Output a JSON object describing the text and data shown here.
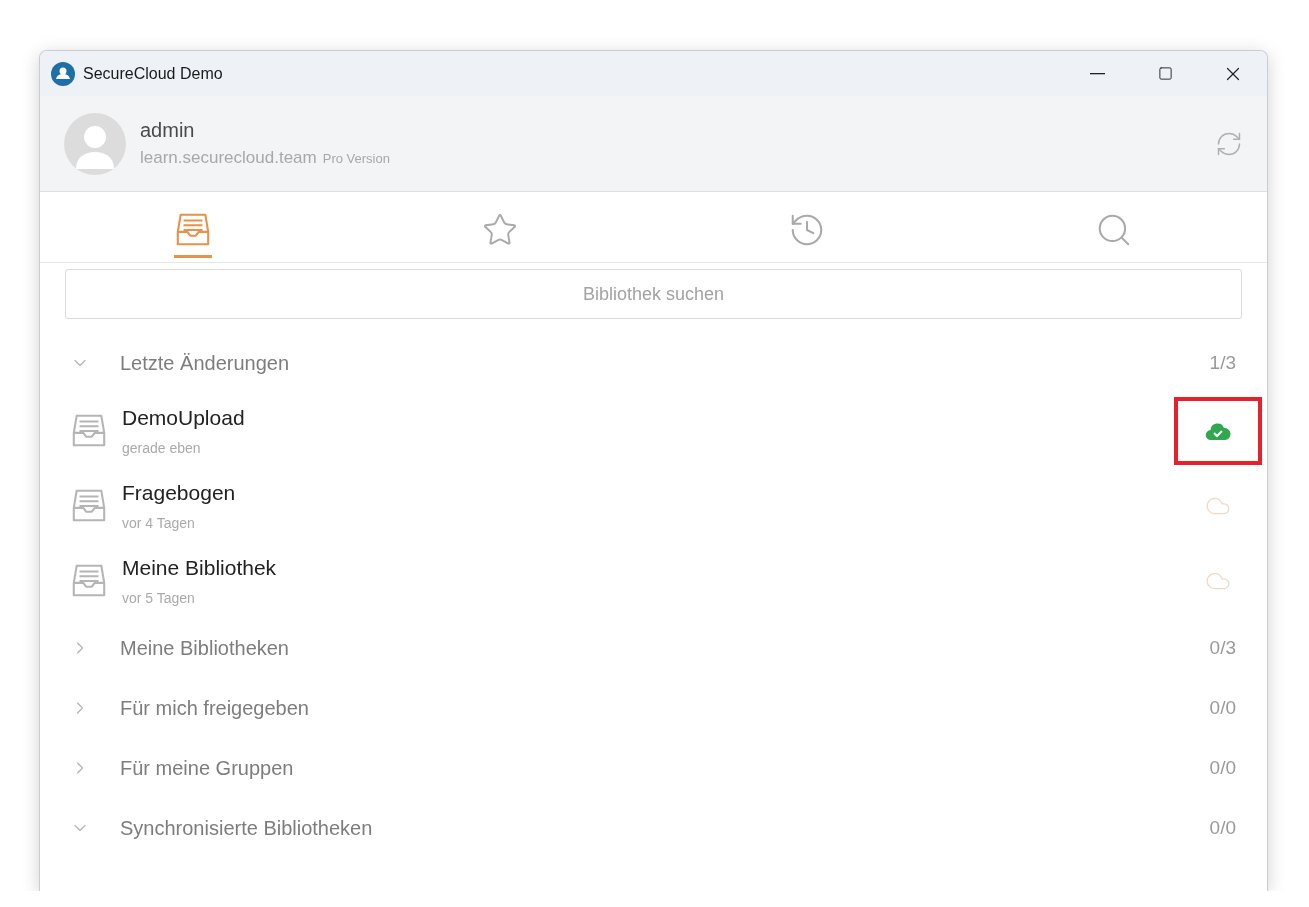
{
  "window": {
    "title": "SecureCloud Demo"
  },
  "account": {
    "name": "admin",
    "server": "learn.securecloud.team",
    "edition": "Pro Version"
  },
  "tabs": [
    {
      "kind": "libraries",
      "selected": true
    },
    {
      "kind": "starred",
      "selected": false
    },
    {
      "kind": "history",
      "selected": false
    },
    {
      "kind": "search",
      "selected": false
    }
  ],
  "search": {
    "placeholder": "Bibliothek suchen"
  },
  "sections": [
    {
      "label": "Letzte Änderungen",
      "count": "1/3",
      "expanded": true,
      "items": [
        {
          "name": "DemoUpload",
          "time": "gerade eben",
          "synced": true,
          "highlighted": true
        },
        {
          "name": "Fragebogen",
          "time": "vor 4 Tagen",
          "synced": false,
          "highlighted": false
        },
        {
          "name": "Meine Bibliothek",
          "time": "vor 5 Tagen",
          "synced": false,
          "highlighted": false
        }
      ]
    },
    {
      "label": "Meine Bibliotheken",
      "count": "0/3",
      "expanded": false
    },
    {
      "label": "Für mich freigegeben",
      "count": "0/0",
      "expanded": false
    },
    {
      "label": "Für meine Gruppen",
      "count": "0/0",
      "expanded": false
    },
    {
      "label": "Synchronisierte Bibliotheken",
      "count": "0/0",
      "expanded": true
    }
  ]
}
